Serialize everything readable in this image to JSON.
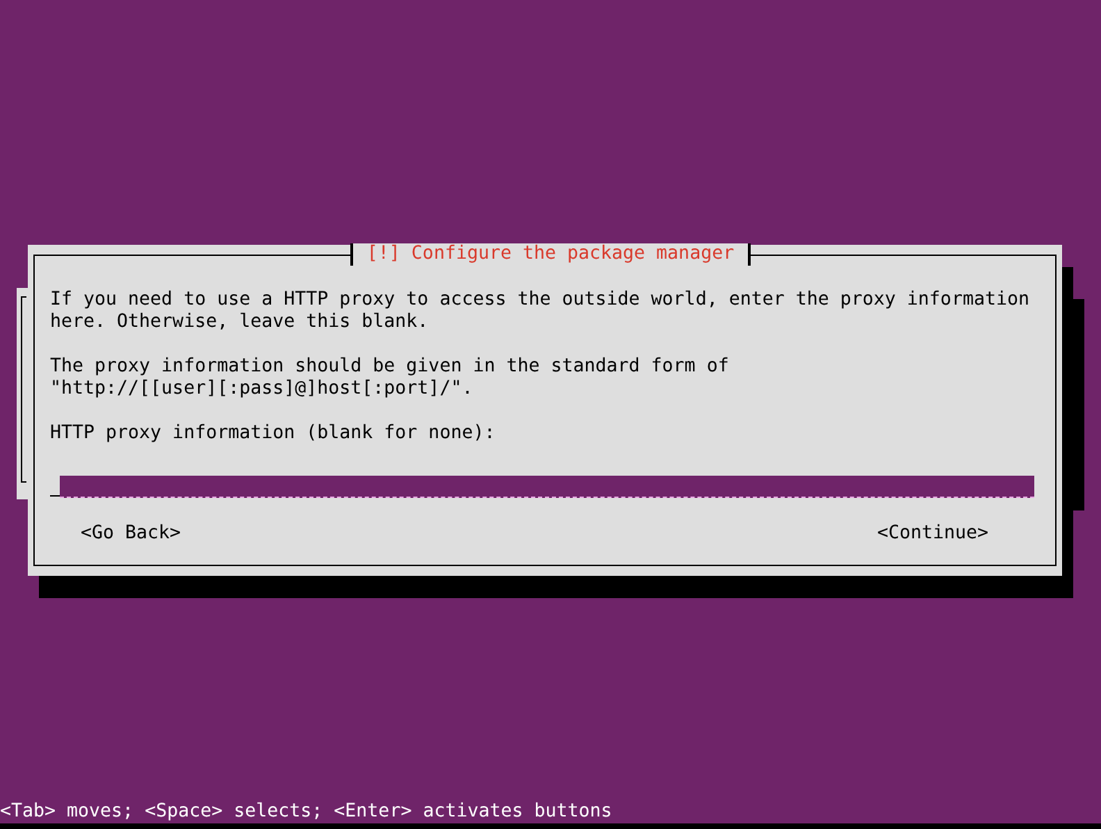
{
  "dialog": {
    "title": "[!] Configure the package manager",
    "paragraphs": [
      "If you need to use a HTTP proxy to access the outside world, enter the proxy information\nhere. Otherwise, leave this blank.",
      "The proxy information should be given in the standard form of\n\"http://[[user][:pass]@]host[:port]/\".",
      "HTTP proxy information (blank for none):"
    ],
    "buttons": [
      {
        "label": "<Go Back>",
        "selected": false
      },
      {
        "label": "<Continue>",
        "selected": false
      }
    ]
  },
  "status_bar": "<Tab> moves; <Space> selects; <Enter> activates buttons"
}
